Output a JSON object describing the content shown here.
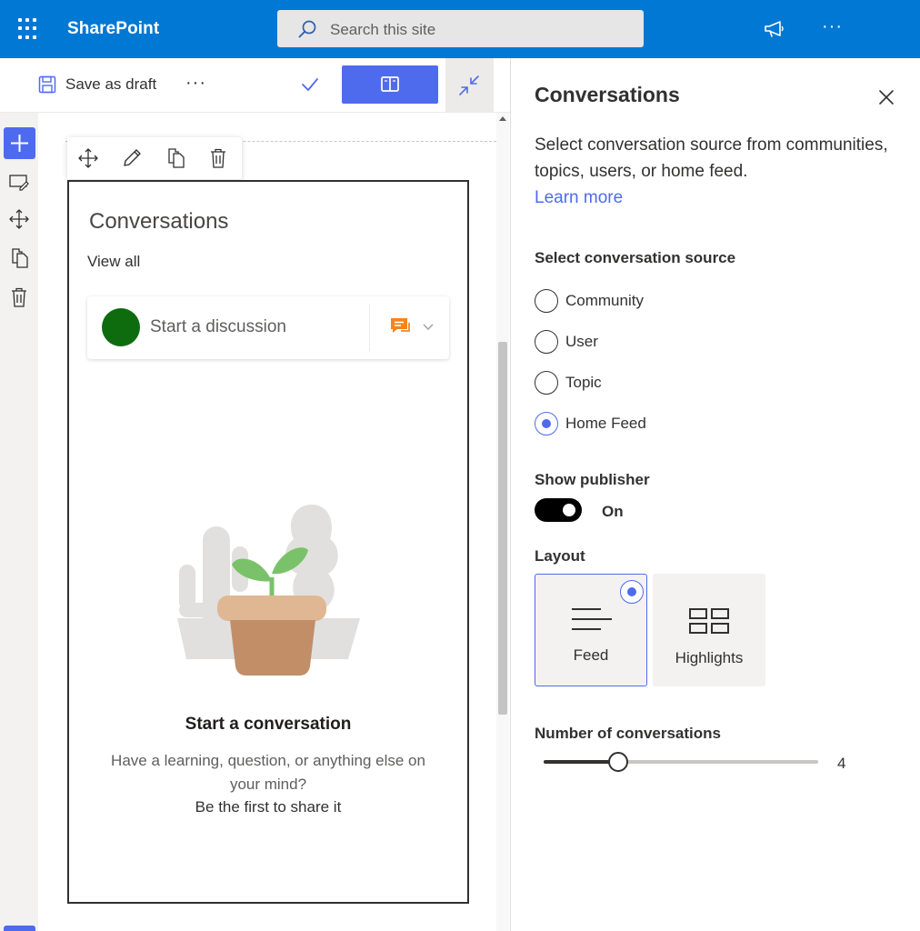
{
  "suite": {
    "app_name": "SharePoint",
    "search_placeholder": "Search this site",
    "more_glyph": "···",
    "accent": "#0078d4"
  },
  "commandbar": {
    "save_label": "Save as draft",
    "more_glyph": "···",
    "primary_accent": "#4f6bed"
  },
  "icons": {
    "waffle": "waffle-icon",
    "search": "search-icon",
    "megaphone": "megaphone-icon",
    "save": "save-icon",
    "check": "checkmark-icon",
    "book": "book-icon",
    "collapse": "collapse-icon",
    "add": "add-icon",
    "edit": "edit-icon",
    "move": "move-icon",
    "duplicate": "duplicate-icon",
    "delete": "delete-icon",
    "close": "close-icon"
  },
  "webpart": {
    "title": "Conversations",
    "view_all": "View all",
    "publisher_placeholder": "Start a discussion",
    "empty_title": "Start a conversation",
    "empty_desc": "Have a learning, question, or anything else on your mind?",
    "empty_cta": "Be the first to share it"
  },
  "pane": {
    "title": "Conversations",
    "description": "Select conversation source from communities, topics, users, or home feed.",
    "learn_more": "Learn more",
    "source_label": "Select conversation source",
    "sources": [
      {
        "label": "Community",
        "selected": false
      },
      {
        "label": "User",
        "selected": false
      },
      {
        "label": "Topic",
        "selected": false
      },
      {
        "label": "Home Feed",
        "selected": true
      }
    ],
    "publisher_label": "Show publisher",
    "publisher_state": "On",
    "layout_label": "Layout",
    "layouts": [
      {
        "label": "Feed",
        "selected": true
      },
      {
        "label": "Highlights",
        "selected": false
      }
    ],
    "count_label": "Number of conversations",
    "count_value": "4",
    "count_fraction": 0.27
  }
}
